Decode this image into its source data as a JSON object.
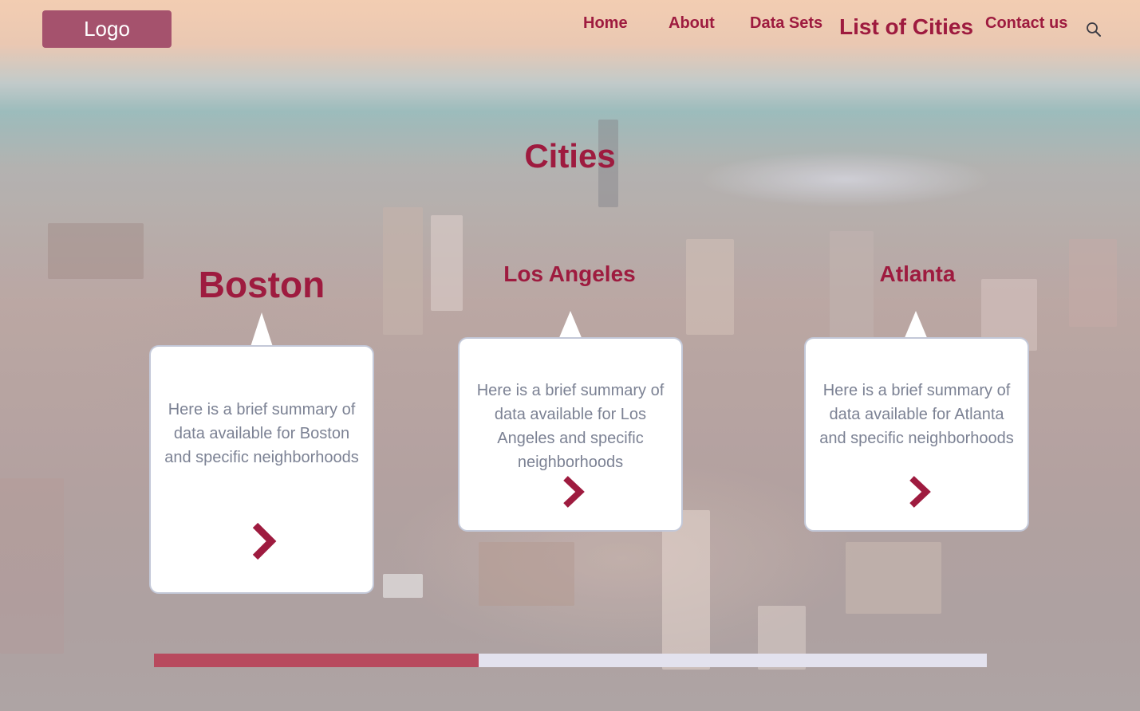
{
  "logo": {
    "label": "Logo"
  },
  "nav": {
    "home": "Home",
    "about": "About",
    "data_sets": "Data Sets",
    "list_of_cities": "List of Cities",
    "contact": "Contact us",
    "search_icon": "search-icon"
  },
  "page": {
    "title": "Cities"
  },
  "cities": [
    {
      "name": "Boston",
      "summary": "Here is a brief summary of data available for Boston and specific neighborhoods",
      "arrow_icon": "chevron-right-icon"
    },
    {
      "name": "Los Angeles",
      "summary": "Here is a brief summary of data available for Los Angeles and specific neighborhoods",
      "arrow_icon": "chevron-right-icon"
    },
    {
      "name": "Atlanta",
      "summary": "Here is a brief summary of data available for Atlanta and specific neighborhoods",
      "arrow_icon": "chevron-right-icon"
    }
  ],
  "carousel": {
    "progress": 0.39
  },
  "colors": {
    "accent": "#9e1b3f",
    "progress_fill": "#b84a5e",
    "progress_track": "#e3e2ee",
    "logo_bg": "#a5526d"
  }
}
